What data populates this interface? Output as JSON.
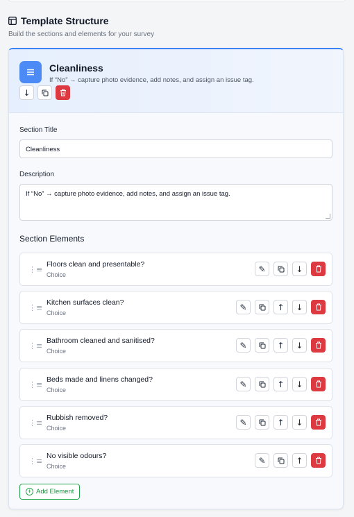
{
  "header": {
    "title": "Template Structure",
    "subtitle": "Build the sections and elements for your survey"
  },
  "section": {
    "title": "Cleanliness",
    "description": "If “No” → capture photo evidence, add notes, and assign an issue tag.",
    "icon": "list-icon",
    "accent_color": "#3b82f6",
    "actions": [
      "move-down",
      "duplicate",
      "delete"
    ]
  },
  "form": {
    "title_label": "Section Title",
    "title_value": "Cleanliness",
    "description_label": "Description",
    "description_value": "If “No” → capture photo evidence, add notes, and assign an issue tag."
  },
  "elements": {
    "heading": "Section Elements",
    "items": [
      {
        "name": "Floors clean and presentable?",
        "type": "Choice"
      },
      {
        "name": "Kitchen surfaces clean?",
        "type": "Choice"
      },
      {
        "name": "Bathroom cleaned and sanitised?",
        "type": "Choice"
      },
      {
        "name": "Beds made and linens changed?",
        "type": "Choice"
      },
      {
        "name": "Rubbish removed?",
        "type": "Choice"
      },
      {
        "name": "No visible odours?",
        "type": "Choice"
      }
    ]
  },
  "add_element_label": "Add Element",
  "colors": {
    "danger": "#dc3a40",
    "success": "#22a54a",
    "primary": "#4c8af6"
  }
}
